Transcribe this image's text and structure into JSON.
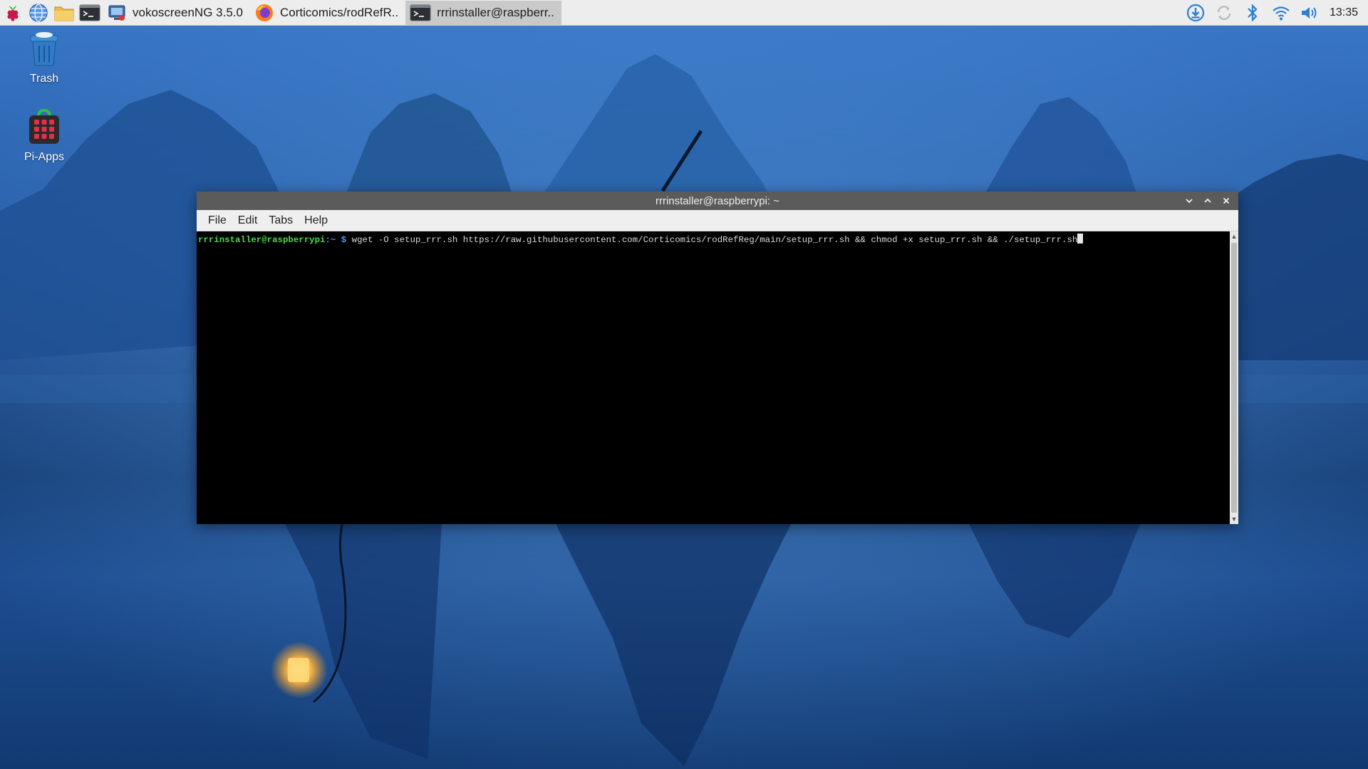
{
  "taskbar": {
    "launchers": [
      {
        "icon": "raspberry-menu-icon"
      },
      {
        "icon": "web-browser-icon"
      },
      {
        "icon": "file-manager-icon"
      },
      {
        "icon": "terminal-icon"
      }
    ],
    "tasks": [
      {
        "label": "vokoscreenNG 3.5.0",
        "icon": "vokoscreen-icon",
        "active": false
      },
      {
        "label": "Corticomics/rodRefR..",
        "icon": "firefox-icon",
        "active": false
      },
      {
        "label": "rrrinstaller@raspberr..",
        "icon": "terminal-icon",
        "active": true
      }
    ],
    "tray": [
      "download-icon",
      "sync-icon",
      "bluetooth-icon",
      "wifi-icon",
      "volume-icon"
    ],
    "clock": "13:35"
  },
  "desktop": {
    "icons": [
      {
        "label": "Trash",
        "icon": "trash-icon"
      },
      {
        "label": "Pi-Apps",
        "icon": "pi-apps-icon"
      }
    ]
  },
  "terminal": {
    "title": "rrrinstaller@raspberrypi: ~",
    "menu": [
      "File",
      "Edit",
      "Tabs",
      "Help"
    ],
    "prompt_user": "rrrinstaller@raspberrypi",
    "prompt_path": ":~ $",
    "command": " wget -O setup_rrr.sh https://raw.githubusercontent.com/Corticomics/rodRefReg/main/setup_rrr.sh && chmod +x setup_rrr.sh && ./setup_rrr.sh"
  },
  "colors": {
    "taskbar_bg": "#ededed",
    "active_task_bg": "#c9c9c9",
    "titlebar_bg": "#5b5b5b",
    "prompt_user": "#4fd64f",
    "prompt_path": "#5a8ff0",
    "tray_accent": "#2a7fd4"
  }
}
